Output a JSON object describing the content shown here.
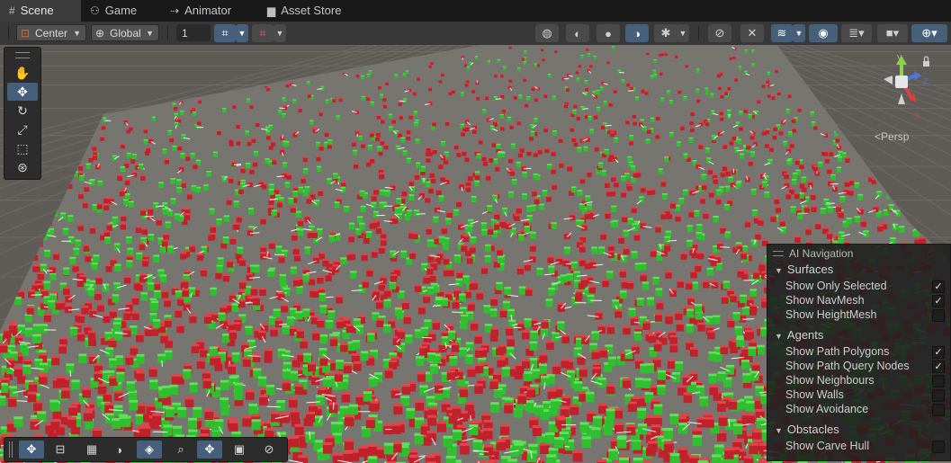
{
  "tabs": [
    {
      "label": "Scene",
      "icon": "grid-icon",
      "active": true
    },
    {
      "label": "Game",
      "icon": "gamepad-icon",
      "active": false
    },
    {
      "label": "Animator",
      "icon": "animator-icon",
      "active": false
    },
    {
      "label": "Asset Store",
      "icon": "bag-icon",
      "active": false
    }
  ],
  "toolbar": {
    "pivot": "Center",
    "space": "Global",
    "snap_value": "1"
  },
  "gizmo": {
    "axis_y": "y",
    "axis_z": "z",
    "axis_x": "x",
    "projection": "Persp"
  },
  "nav_panel": {
    "title": "AI Navigation",
    "sections": [
      {
        "title": "Surfaces",
        "items": [
          {
            "label": "Show Only Selected",
            "checked": true
          },
          {
            "label": "Show NavMesh",
            "checked": true
          },
          {
            "label": "Show HeightMesh",
            "checked": false
          }
        ]
      },
      {
        "title": "Agents",
        "items": [
          {
            "label": "Show Path Polygons",
            "checked": true
          },
          {
            "label": "Show Path Query Nodes",
            "checked": true
          },
          {
            "label": "Show Neighbours",
            "checked": false
          },
          {
            "label": "Show Walls",
            "checked": false
          },
          {
            "label": "Show Avoidance",
            "checked": false
          }
        ]
      },
      {
        "title": "Obstacles",
        "items": [
          {
            "label": "Show Carve Hull",
            "checked": false
          }
        ]
      }
    ]
  },
  "colors": {
    "accent": "#46607c",
    "agent_red": "#c0212b",
    "agent_green": "#2fbf2f",
    "ground": "#5f5b57"
  }
}
